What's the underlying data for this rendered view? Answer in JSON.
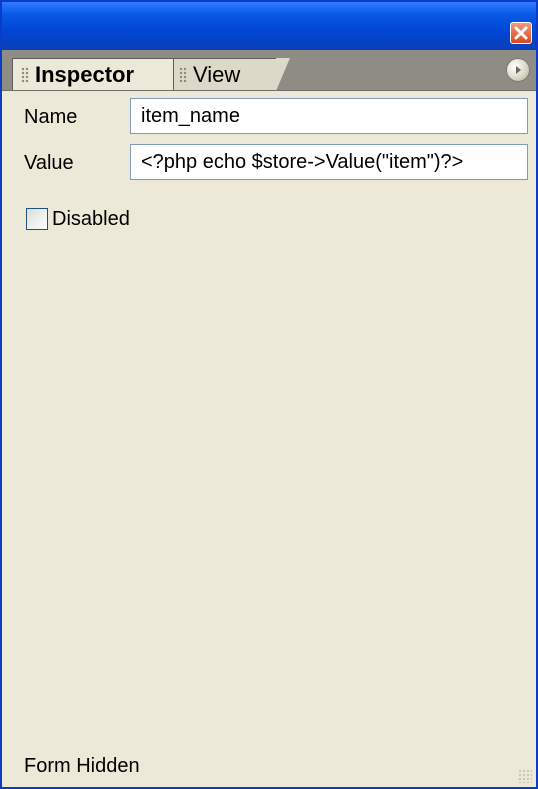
{
  "window": {
    "accent_color": "#0a3cc8",
    "close_icon": "close-icon"
  },
  "tabs": [
    {
      "label": "Inspector",
      "active": true
    },
    {
      "label": "View",
      "active": false
    }
  ],
  "options_icon": "panel-options-icon",
  "fields": {
    "name_label": "Name",
    "name_value": "item_name",
    "value_label": "Value",
    "value_value": "<?php echo $store->Value(\"item\")?>"
  },
  "checkbox": {
    "label": "Disabled",
    "checked": false
  },
  "status": {
    "text": "Form Hidden"
  }
}
